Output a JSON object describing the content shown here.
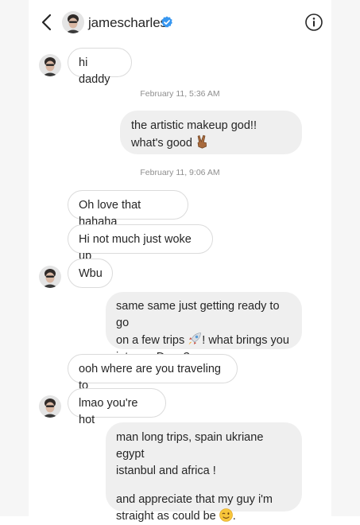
{
  "header": {
    "back_icon": "chevron-left-icon",
    "username": "jamescharles",
    "verified_icon": "verified-badge-icon",
    "info_icon": "info-circle-icon",
    "verified_color": "#3897f0"
  },
  "messages": {
    "m1": "hi daddy",
    "ts1": "February 11, 5:36 AM",
    "m2": "the artistic makeup god!! what's good",
    "ts2": "February 11, 9:06 AM",
    "m3": "Oh love that hahaha",
    "m4": "Hi not much just woke up",
    "m5": "Wbu",
    "m6_a": "same same just getting ready to go",
    "m6_b": "on a few trips",
    "m6_c": "! what brings you",
    "m6_d": "into my Dms ?",
    "m7": "ooh where are you traveling to",
    "m8": "lmao you're hot",
    "m9_a": "man long trips, spain ukriane egypt",
    "m9_b": "istanbul and africa !",
    "m9_c": "and appreciate that my guy i'm",
    "m9_d": "straight as could be",
    "m9_e": "."
  },
  "emojis": {
    "peace": "victory-hand-emoji",
    "rocket": "rocket-emoji",
    "wink": "winking-face-emoji"
  },
  "colors": {
    "incoming_border": "#dbdbdb",
    "outgoing_bg": "#efefef",
    "timestamp": "#8e8e8e"
  }
}
